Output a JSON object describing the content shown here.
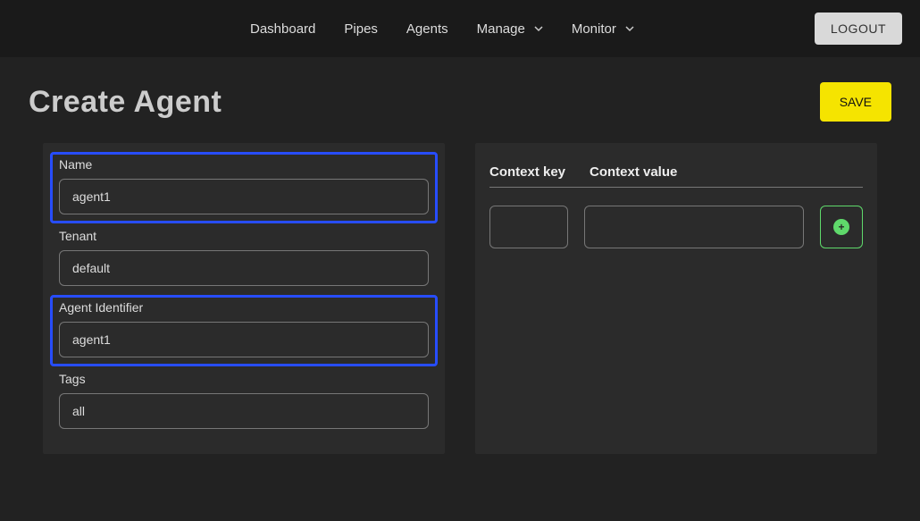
{
  "nav": {
    "items": [
      "Dashboard",
      "Pipes",
      "Agents",
      "Manage",
      "Monitor"
    ],
    "logout": "LOGOUT"
  },
  "header": {
    "title": "Create Agent",
    "save": "SAVE"
  },
  "form": {
    "name": {
      "label": "Name",
      "value": "agent1"
    },
    "tenant": {
      "label": "Tenant",
      "value": "default"
    },
    "identifier": {
      "label": "Agent Identifier",
      "value": "agent1"
    },
    "tags": {
      "label": "Tags",
      "value": "all"
    }
  },
  "context": {
    "keyHeader": "Context key",
    "valueHeader": "Context value",
    "row": {
      "key": "",
      "value": ""
    }
  }
}
